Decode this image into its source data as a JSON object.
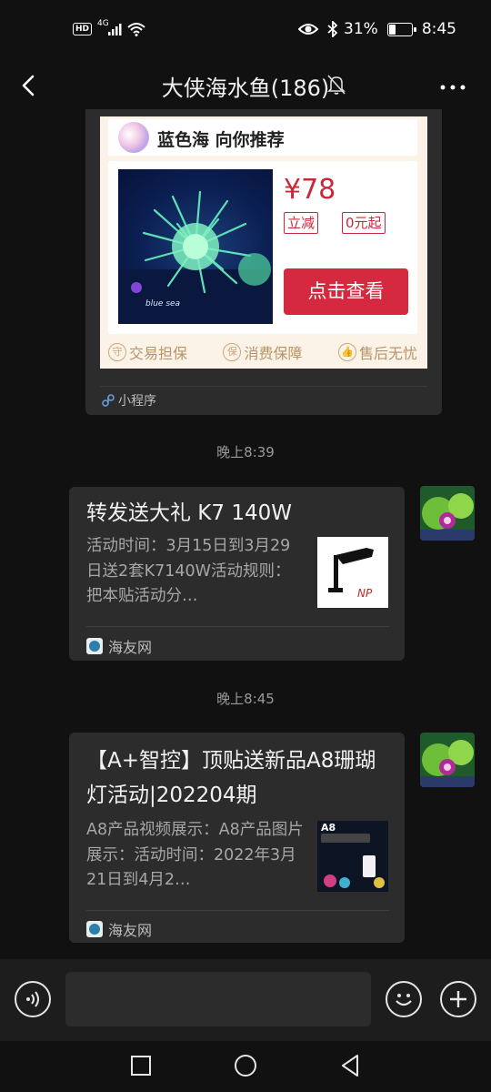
{
  "status_bar": {
    "network": "4G",
    "battery": "31%",
    "battery_level": 0.31,
    "time": "8:45"
  },
  "header": {
    "title": "大侠海水鱼(186)"
  },
  "mini_program": {
    "recommend_text": "蓝色海 向你推荐",
    "price": "¥78",
    "tag_discount": "立减",
    "tag_start": "0元起",
    "watermark": "blue sea",
    "view_button": "点击查看",
    "guarantees": [
      {
        "icon": "守",
        "label": "交易担保"
      },
      {
        "icon": "保",
        "label": "消费保障"
      },
      {
        "icon": "👍",
        "label": "售后无忧"
      }
    ],
    "source": "小程序"
  },
  "messages": [
    {
      "time": "晚上8:39",
      "title": "转发送大礼  K7 140W",
      "desc": "活动时间：3月15日到3月29日送2套K7140W活动规则：把本贴活动分…",
      "source": "海友网"
    },
    {
      "time": "晚上8:45",
      "title": "【A+智控】顶贴送新品A8珊瑚灯活动|202204期",
      "desc": "A8产品视频展示：A8产品图片展示：活动时间：2022年3月21日到4月2…",
      "source": "海友网",
      "thumb_label": "A8"
    }
  ],
  "input": {
    "value": ""
  }
}
